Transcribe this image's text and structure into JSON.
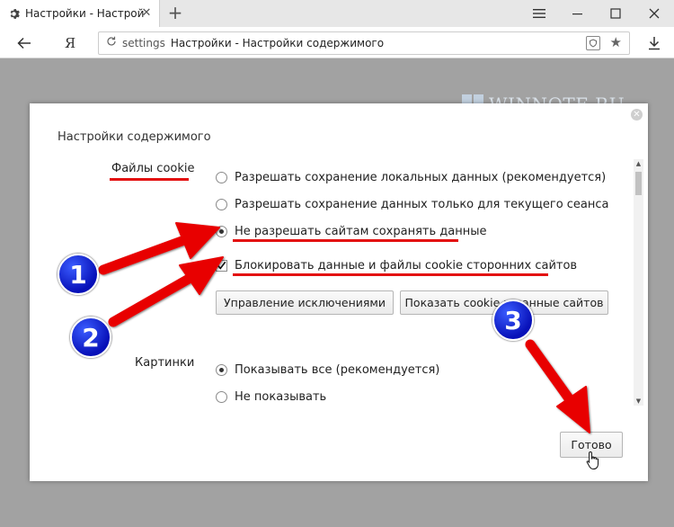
{
  "browser": {
    "tab_title": "Настройки - Настройки с",
    "new_tab": "+",
    "yandex_button": "Я",
    "address": {
      "scheme": "settings",
      "title": "Настройки - Настройки содержимого"
    }
  },
  "dialog": {
    "title": "Настройки содержимого",
    "cookies": {
      "label": "Файлы cookie",
      "options": [
        "Разрешать сохранение локальных данных (рекомендуется)",
        "Разрешать сохранение данных только для текущего сеанса",
        "Не разрешать сайтам сохранять данные"
      ],
      "selected_index": 2,
      "block_third_party": {
        "label": "Блокировать данные и файлы cookie сторонних сайтов",
        "checked": true
      },
      "manage_exceptions_label": "Управление исключениями",
      "show_cookies_label": "Показать cookie и данные сайтов"
    },
    "images": {
      "label": "Картинки",
      "options": [
        "Показывать все (рекомендуется)",
        "Не показывать"
      ],
      "selected_index": 0
    },
    "done_label": "Готово"
  },
  "watermark": "WINNOTE.RU",
  "annotations": {
    "badges": [
      "1",
      "2",
      "3"
    ],
    "arrow_color": "#e80000",
    "underline_color": "#e31010",
    "badge_color": "#0a14c8"
  }
}
